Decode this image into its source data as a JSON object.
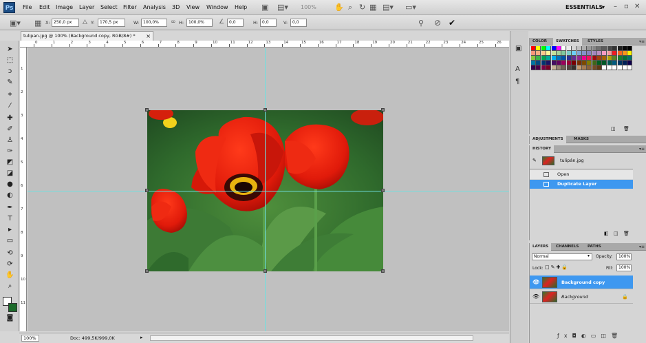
{
  "app": {
    "logo": "Ps",
    "menu": [
      "File",
      "Edit",
      "Image",
      "Layer",
      "Select",
      "Filter",
      "Analysis",
      "3D",
      "View",
      "Window",
      "Help"
    ],
    "zoom_menu_value": "100%",
    "workspace": "ESSENTIALS",
    "workspace_caret": "▾",
    "window_controls": [
      "–",
      "▫",
      "✕"
    ]
  },
  "options_bar": {
    "x_label": "X:",
    "x_value": "250,0 px",
    "y_label": "Y:",
    "y_value": "170,5 px",
    "w_label": "W:",
    "w_value": "100,0%",
    "h_label": "H:",
    "h_value": "100,0%",
    "angle_value": "0,0",
    "h_skew_label": "H:",
    "h_skew_value": "0,0",
    "v_skew_label": "V:",
    "v_skew_value": "0,0",
    "cancel_icon": "⊘",
    "commit_icon": "✔"
  },
  "document": {
    "tab_title": "tulipan.jpg @ 100% (Background copy, RGB/8#) *",
    "tab_close": "×"
  },
  "ruler_numbers": [
    "0",
    "1",
    "2",
    "3",
    "4",
    "5",
    "6",
    "7",
    "8",
    "9",
    "10",
    "11",
    "12",
    "13",
    "14",
    "15",
    "16",
    "17",
    "18",
    "19",
    "20",
    "21",
    "22",
    "23",
    "24",
    "25",
    "26"
  ],
  "ruler_left_numbers": [
    "1",
    "2",
    "3",
    "4",
    "5",
    "6",
    "7",
    "8",
    "9",
    "10",
    "11"
  ],
  "status": {
    "zoom": "100%",
    "doc": "Doc: 499,5K/999,0K"
  },
  "tools": [
    "move",
    "marquee",
    "lasso",
    "quick-select",
    "crop",
    "eyedropper",
    "spot-heal",
    "brush",
    "clone-stamp",
    "history-brush",
    "eraser",
    "gradient",
    "blur",
    "dodge",
    "pen",
    "type",
    "path-select",
    "shape",
    "3d-rotate",
    "3d-orbit",
    "hand",
    "zoom"
  ],
  "panels": {
    "color_tabs": [
      "COLOR",
      "SWATCHES",
      "STYLES"
    ],
    "adjust_tabs": [
      "ADJUSTMENTS",
      "MASKS"
    ],
    "history_tab": "HISTORY",
    "history_snapshot": "tulipán.jpg",
    "history_steps": [
      "Open",
      "Duplicate Layer"
    ],
    "layers_tabs": [
      "LAYERS",
      "CHANNELS",
      "PATHS"
    ],
    "blend_mode": "Normal",
    "opacity_label": "Opacity:",
    "opacity_value": "100%",
    "lock_label": "Lock:",
    "fill_label": "Fill:",
    "fill_value": "100%",
    "layers": [
      {
        "name": "Background copy",
        "selected": true
      },
      {
        "name": "Background",
        "selected": false,
        "locked": true
      }
    ],
    "lock_icon": "🔒",
    "menu_glyph": "▾≡"
  },
  "swatch_colors": [
    "#ff0000",
    "#ffff00",
    "#00ff00",
    "#00ffff",
    "#0000ff",
    "#ff00ff",
    "#ffffff",
    "#ebebeb",
    "#d6d6d6",
    "#c2c2c2",
    "#adadad",
    "#999999",
    "#858585",
    "#707070",
    "#5c5c5c",
    "#474747",
    "#333333",
    "#1f1f1f",
    "#0a0a0a",
    "#000000",
    "#f7977a",
    "#f9ad81",
    "#fdc68a",
    "#fff79a",
    "#c4df9b",
    "#a3d39c",
    "#82ca9d",
    "#7bcdc8",
    "#6ecff6",
    "#7ea7d8",
    "#8493ca",
    "#8882be",
    "#a187be",
    "#bc8dbf",
    "#f49ac2",
    "#f6989d",
    "#ed1c24",
    "#f26522",
    "#f7941d",
    "#fff200",
    "#8dc73f",
    "#39b54a",
    "#00a651",
    "#00a99d",
    "#00aeef",
    "#0072bc",
    "#0054a6",
    "#2e3192",
    "#662d91",
    "#92278f",
    "#ec008c",
    "#ed145b",
    "#9e0b0f",
    "#a0410d",
    "#a36209",
    "#aba000",
    "#598527",
    "#1a7b30",
    "#007236",
    "#00746b",
    "#0076a3",
    "#004b80",
    "#003471",
    "#1b1464",
    "#440e62",
    "#630460",
    "#9e005d",
    "#9e0039",
    "#790000",
    "#7b2e00",
    "#7d4900",
    "#827b00",
    "#406618",
    "#005e20",
    "#005826",
    "#005952",
    "#005b7f",
    "#003663",
    "#002157",
    "#0d004c",
    "#32004b",
    "#4b0049",
    "#7b0046",
    "#7a0026",
    "#c7b299",
    "#998675",
    "#736357",
    "#534741",
    "#37302a",
    "#c69c6d",
    "#a67c52",
    "#8c6239",
    "#754c24",
    "#603913",
    "#ffffff",
    "#ffffff",
    "#ffffff",
    "#ffffff",
    "#ffffff",
    "#ffffff"
  ]
}
